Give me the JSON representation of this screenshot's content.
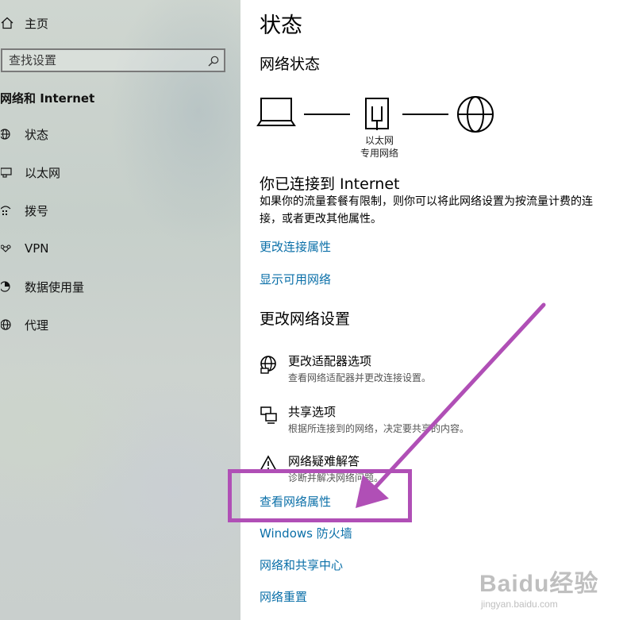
{
  "sidebar": {
    "home_label": "主页",
    "search_placeholder": "查找设置",
    "section_title": "网络和 Internet",
    "items": [
      {
        "label": "状态",
        "icon": "home-status-icon"
      },
      {
        "label": "以太网",
        "icon": "ethernet-icon"
      },
      {
        "label": "拨号",
        "icon": "dialup-icon"
      },
      {
        "label": "VPN",
        "icon": "vpn-icon"
      },
      {
        "label": "数据使用量",
        "icon": "data-usage-icon"
      },
      {
        "label": "代理",
        "icon": "globe-icon"
      }
    ]
  },
  "main": {
    "title": "状态",
    "network_status_heading": "网络状态",
    "diagram": {
      "device_label_line1": "以太网",
      "device_label_line2": "专用网络"
    },
    "connected_heading": "你已连接到 Internet",
    "connected_desc": "如果你的流量套餐有限制，则你可以将此网络设置为按流量计费的连接，或者更改其他属性。",
    "links_top": [
      "更改连接属性",
      "显示可用网络"
    ],
    "change_heading": "更改网络设置",
    "options": [
      {
        "title": "更改适配器选项",
        "desc": "查看网络适配器并更改连接设置。",
        "icon": "adapter-icon"
      },
      {
        "title": "共享选项",
        "desc": "根据所连接到的网络，决定要共享的内容。",
        "icon": "sharing-icon"
      },
      {
        "title": "网络疑难解答",
        "desc": "诊断并解决网络问题。",
        "icon": "warning-icon"
      }
    ],
    "links_bottom": [
      "查看网络属性",
      "Windows 防火墙",
      "网络和共享中心",
      "网络重置"
    ]
  },
  "watermark": {
    "logo": "Baidu经验",
    "sub": "jingyan.baidu.com"
  },
  "colors": {
    "link": "#0a6fa8",
    "annotation": "#b04fb6"
  }
}
